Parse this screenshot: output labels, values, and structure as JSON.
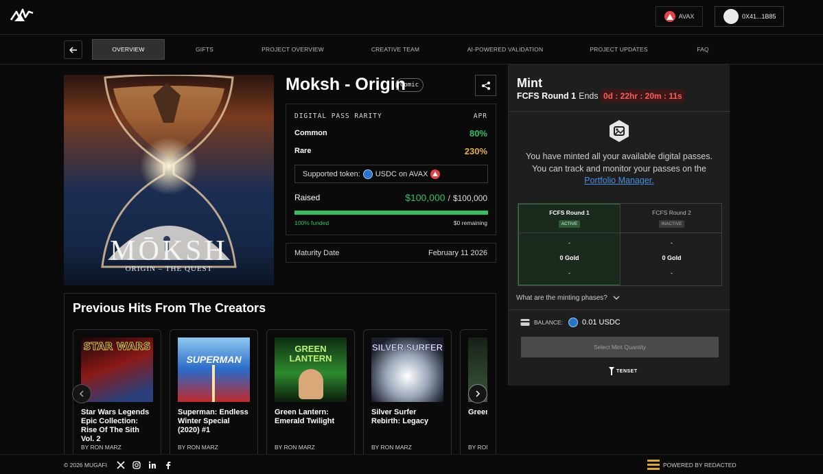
{
  "header": {
    "network_label": "AVAX",
    "wallet_label": "0X41...1B85"
  },
  "nav": {
    "tabs": [
      {
        "label": "OVERVIEW"
      },
      {
        "label": "GIFTS"
      },
      {
        "label": "PROJECT OVERVIEW"
      },
      {
        "label": "CREATIVE TEAM"
      },
      {
        "label": "AI-POWERED VALIDATION"
      },
      {
        "label": "PROJECT UPDATES"
      },
      {
        "label": "FAQ"
      }
    ]
  },
  "project": {
    "title": "Moksh - Origin",
    "badge": "Comic",
    "cover_title": "MŌKSH",
    "cover_subtitle": "ORIGIN – THE QUEST"
  },
  "info": {
    "header_left": "DIGITAL PASS RARITY",
    "header_right": "APR",
    "rows": [
      {
        "name": "Common",
        "value": "80%"
      },
      {
        "name": "Rare",
        "value": "230%"
      }
    ],
    "supported_label": "Supported token:",
    "supported_value": "USDC on AVAX",
    "raised_label": "Raised",
    "raised_value": "$100,000",
    "raised_sep": "/",
    "raised_goal": "$100,000",
    "progress_fraction": 1.0,
    "funded_label": "100% funded",
    "remaining_label": "$0 remaining",
    "maturity_label": "Maturity Date",
    "maturity_value": "February 11 2026"
  },
  "prev_hits": {
    "title": "Previous Hits From The Creators",
    "cards": [
      {
        "title": "Star Wars Legends Epic Collection: Rise Of The Sith Vol. 2",
        "author": "BY RON MARZ",
        "cover_text": "STAR WARS"
      },
      {
        "title": "Superman: Endless Winter Special (2020) #1",
        "author": "BY RON MARZ",
        "cover_text": "SUPERMAN"
      },
      {
        "title": "Green Lantern: Emerald Twilight",
        "author": "BY RON MARZ",
        "cover_text": "GREEN LANTERN"
      },
      {
        "title": "Silver Surfer Rebirth: Legacy",
        "author": "BY RON MARZ",
        "cover_text": "SILVER SURFER"
      },
      {
        "title": "Green Aliens",
        "author": "BY RON",
        "cover_text": ""
      }
    ]
  },
  "mint": {
    "title": "Mint",
    "round_label": "FCFS Round 1",
    "ends_label": "Ends In:",
    "timer": "0d : 22hr : 20m : 11s",
    "message_1": "You have minted all your available digital passes.",
    "message_2": "You can track and monitor your passes on the",
    "link_text": "Portfolio Manager.",
    "phases": [
      {
        "name": "FCFS Round 1",
        "status": "ACTIVE",
        "top": "-",
        "gold": "0 Gold",
        "bottom": "-"
      },
      {
        "name": "FCFS Round 2",
        "status": "INACTIVE",
        "top": "-",
        "gold": "0 Gold",
        "bottom": "-"
      }
    ],
    "phases_question": "What are the minting phases?",
    "balance_label": "BALANCE:",
    "balance_value": "0.01 USDC",
    "select_button": "Select Mint Quantity",
    "partner_logo": "TENSET"
  },
  "footer": {
    "copyright": "© 2026 MUGAFI",
    "powered_by": "POWERED BY REDACTED"
  },
  "colors": {
    "accent_green": "#31c064",
    "timer_red": "#ff5c5c",
    "link_blue": "#4a90e2",
    "avax_red": "#e84142",
    "usdc_blue": "#2775ca"
  }
}
